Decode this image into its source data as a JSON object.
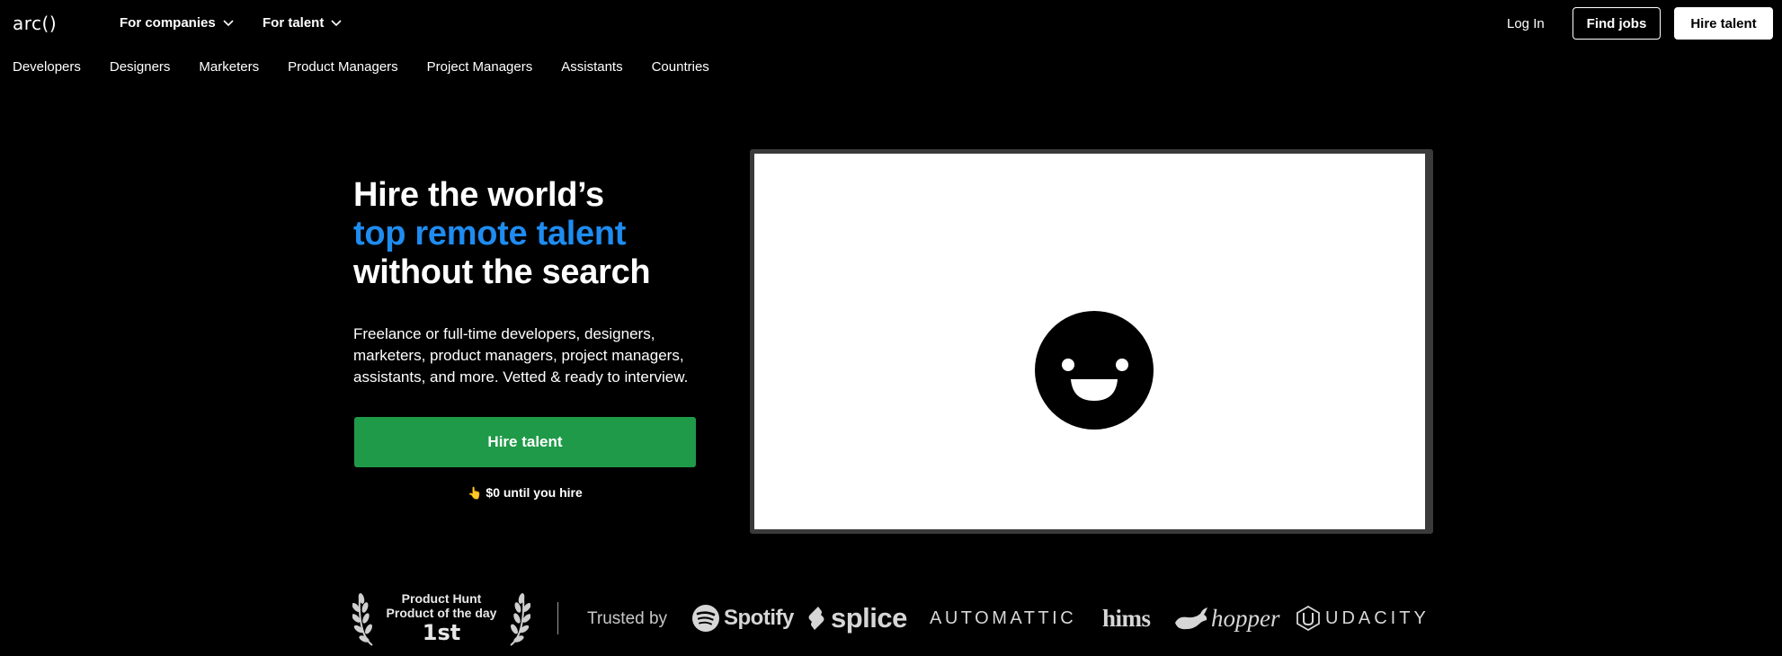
{
  "header": {
    "logo": "arc()",
    "nav_companies": "For companies",
    "nav_talent": "For talent",
    "login": "Log In",
    "find_jobs": "Find jobs",
    "hire_talent": "Hire talent"
  },
  "subnav": {
    "items": [
      "Developers",
      "Designers",
      "Marketers",
      "Product Managers",
      "Project Managers",
      "Assistants",
      "Countries"
    ]
  },
  "hero": {
    "title_line1": "Hire the world’s",
    "title_accent": "top remote talent",
    "title_line3": "without the search",
    "description": "Freelance or full-time developers, designers, marketers, product managers, project managers, assistants, and more. Vetted & ready to interview.",
    "cta": "Hire talent",
    "free_note": "$0 until you hire"
  },
  "trust": {
    "ph_line1": "Product Hunt",
    "ph_line2": "Product of the day",
    "ph_rank": "1st",
    "trusted_by": "Trusted by",
    "logos": [
      "Spotify",
      "splice",
      "AUTOMATTIC",
      "hims",
      "hopper",
      "UDACITY"
    ]
  },
  "colors": {
    "background": "#000000",
    "accent_blue": "#1e8cf0",
    "cta_green": "#1f9a48"
  }
}
